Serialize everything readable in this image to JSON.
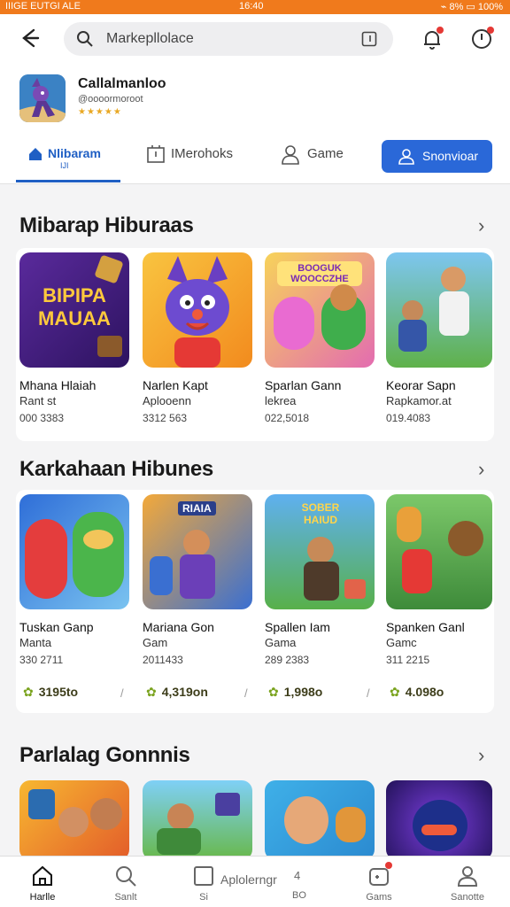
{
  "status": {
    "left": "IIIGE EUTGI ALE",
    "time": "16:40",
    "right": "⌁ 8% ▭ 100%"
  },
  "search": {
    "placeholder": "Markepllolace"
  },
  "app": {
    "name": "Callalmanloo",
    "subtitle": "@oooormoroot",
    "stars": "★★★★★"
  },
  "tabs": [
    {
      "label": "Nlibaram",
      "sub": "IJI"
    },
    {
      "label": "IMerohoks"
    },
    {
      "label": "Game"
    },
    {
      "label": "Snonvioar"
    }
  ],
  "sections": [
    {
      "title": "Mibarap Hiburaas",
      "items": [
        {
          "title": "Mhana Hlaiah",
          "line2": "Rant st",
          "line3": "000 3383",
          "thumb_text": "BIPIPA MAUAA"
        },
        {
          "title": "Narlen Kapt",
          "line2": "Aplooenn",
          "line3": "3312 563"
        },
        {
          "title": "Sparlan Gann",
          "line2": "lekrea",
          "line3": "022,5018",
          "thumb_text": "BOOGUK WOOCCZHE"
        },
        {
          "title": "Keorar Sapn",
          "line2": "Rapkamor.at",
          "line3": "019.4083"
        }
      ]
    },
    {
      "title": "Karkahaan Hibunes",
      "items": [
        {
          "title": "Tuskan Ganp",
          "line2": "Manta",
          "line3": "330 2711",
          "price": "3195to"
        },
        {
          "title": "Mariana Gon",
          "line2": "Gam",
          "line3": "2011433",
          "price": "4,319on",
          "thumb_text": "RIAIA"
        },
        {
          "title": "Spallen Iam",
          "line2": "Gama",
          "line3": "289 2383",
          "price": "1,998o",
          "thumb_text": "SOBER HAIUD"
        },
        {
          "title": "Spanken Ganl",
          "line2": "Gamc",
          "line3": "311 2215",
          "price": "4.098o"
        }
      ]
    },
    {
      "title": "Parlalag Gonnnis",
      "items": [
        {},
        {},
        {},
        {}
      ]
    }
  ],
  "bottom_nav": [
    {
      "label": "Harlle"
    },
    {
      "label": "Sanlt"
    },
    {
      "label": "Si",
      "extra": "Aplolerngr",
      "num": "4",
      "sub": "BO"
    },
    {
      "label": "Gams"
    },
    {
      "label": "Sanotte"
    }
  ],
  "colors": {
    "status_bar": "#f07a1c",
    "accent": "#2a68d8",
    "price_icon": "#7aa31e"
  }
}
